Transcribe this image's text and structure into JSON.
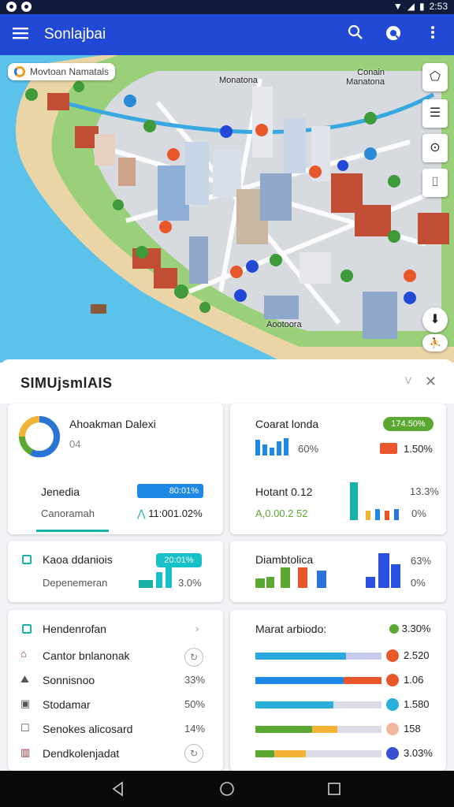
{
  "status": {
    "time": "2:53"
  },
  "appbar": {
    "title": "Sonlajbai",
    "menu_icon": "menu-icon",
    "icons": [
      "search-icon",
      "compass-icon",
      "more-vert-icon"
    ]
  },
  "map": {
    "chip_label": "Movtoan Namatals",
    "labels": [
      "Monatona",
      "Conain Manatona",
      "Aootoora"
    ],
    "tools": [
      "layers-icon",
      "list-icon",
      "locate-icon",
      "bookmark-icon"
    ]
  },
  "sheet": {
    "title": "SIMUjsmlAIS",
    "collapse_label": "V",
    "close_icon": "close-icon"
  },
  "cards": {
    "overview": {
      "title": "Ahoakman Dalexi",
      "subtitle": "04",
      "row_label": "Jenedia",
      "row_pill": "80:01%",
      "row_sub": "Canoramah",
      "row_value": "11:001.02%"
    },
    "metrics": {
      "title": "Coarat londa",
      "pill": "174.50%",
      "val1": "60%",
      "val1b": "1.50%",
      "label2": "Hotant 0.12",
      "sub2": "A,0.00.2 52",
      "val2": "13.3%",
      "val2b": "0%",
      "colors": {
        "green": "#5aa832",
        "red": "#e8572a",
        "blue": "#2a74d8",
        "teal": "#18b3a8"
      }
    },
    "kaoa": {
      "title": "Kaoa ddaniois",
      "subtitle": "Depenemeran",
      "pill": "20:01%",
      "value": "3.0%"
    },
    "diam": {
      "title": "Diambtolica",
      "val1": "63%",
      "val2": "0%"
    },
    "list": {
      "header": "Hendenrofan",
      "items": [
        {
          "label": "Cantor bnlanonak",
          "value": "",
          "icon": "store-icon"
        },
        {
          "label": "Sonnisnoo",
          "value": "33%",
          "icon": "hiker-icon"
        },
        {
          "label": "Stodamar",
          "value": "50%",
          "icon": "image-icon"
        },
        {
          "label": "Senokes alicosard",
          "value": "14%",
          "icon": "square-icon"
        },
        {
          "label": "Dendkolenjadat",
          "value": "",
          "icon": "building-icon"
        }
      ]
    },
    "bars": {
      "header": "Marat arbiodo:",
      "header_pill": "3.30%",
      "rows": [
        {
          "value": "2.520",
          "dot": "#e8572a",
          "segments": [
            {
              "frac": 0.72,
              "color": "#2aa8e0"
            },
            {
              "frac": 0.28,
              "color": "#c9c9f0"
            }
          ]
        },
        {
          "value": "1.06",
          "dot": "#e8572a",
          "segments": [
            {
              "frac": 0.7,
              "color": "#1e88e5"
            },
            {
              "frac": 0.3,
              "color": "#e8572a"
            }
          ]
        },
        {
          "value": "1.580",
          "dot": "#2ab0d8",
          "segments": [
            {
              "frac": 0.62,
              "color": "#2ab0d8"
            },
            {
              "frac": 0.38,
              "color": "#dcdce8"
            }
          ]
        },
        {
          "value": "158",
          "dot": "#f0b7a0",
          "segments": [
            {
              "frac": 0.45,
              "color": "#5aa832"
            },
            {
              "frac": 0.2,
              "color": "#f2b233"
            },
            {
              "frac": 0.35,
              "color": "#dcdce8"
            }
          ]
        },
        {
          "value": "3.03%",
          "dot": "#3a4fd0",
          "segments": [
            {
              "frac": 0.15,
              "color": "#5aa832"
            },
            {
              "frac": 0.25,
              "color": "#f2b233"
            },
            {
              "frac": 0.6,
              "color": "#dcdce8"
            }
          ]
        }
      ]
    }
  },
  "navbar": {
    "icons": [
      "back-icon",
      "home-icon",
      "recents-icon"
    ]
  }
}
